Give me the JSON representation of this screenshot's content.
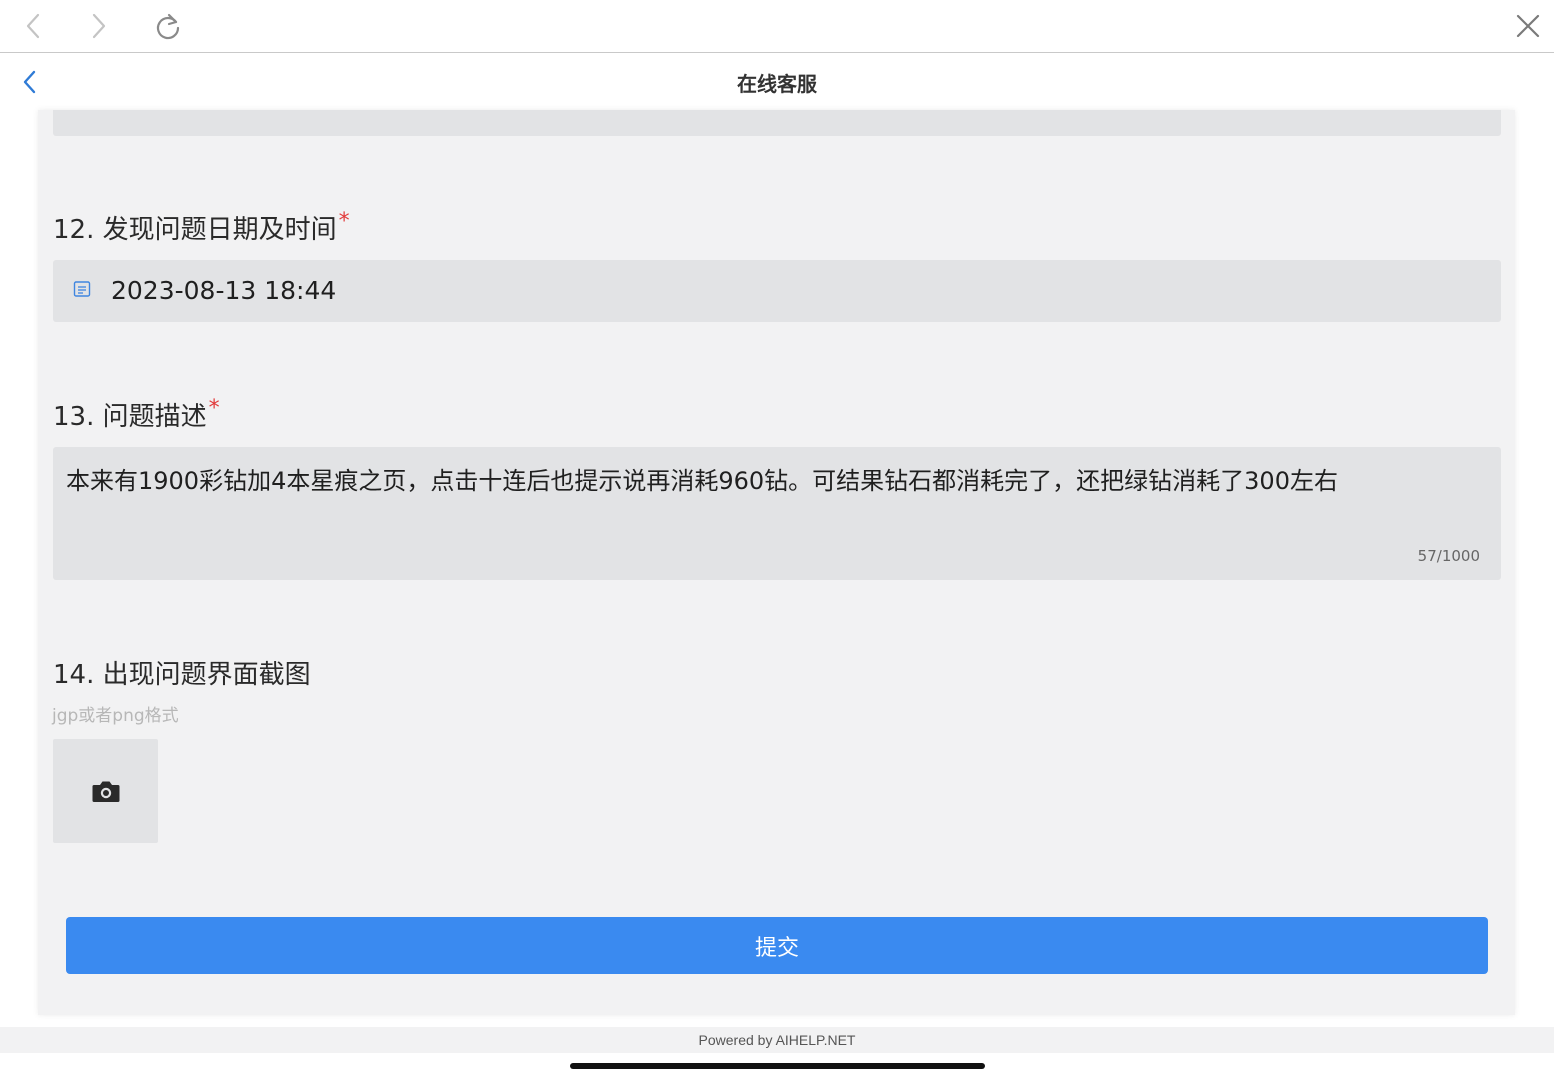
{
  "browser": {
    "back_icon": "chevron-left-icon",
    "forward_icon": "chevron-right-icon",
    "reload_icon": "reload-icon",
    "close_icon": "close-icon"
  },
  "header": {
    "title": "在线客服",
    "back_icon": "chevron-left-icon",
    "accent": "#2f7bd6"
  },
  "form": {
    "q12": {
      "label": "12. 发现问题日期及时间",
      "required_mark": "*",
      "value": "2023-08-13 18:44",
      "icon": "calendar-icon"
    },
    "q13": {
      "label": "13. 问题描述",
      "required_mark": "*",
      "value": "本来有1900彩钻加4本星痕之页，点击十连后也提示说再消耗960钻。可结果钻石都消耗完了，还把绿钻消耗了300左右",
      "counter": "57/1000"
    },
    "q14": {
      "label": "14. 出现问题界面截图",
      "hint": "jgp或者png格式",
      "upload_icon": "camera-icon"
    },
    "submit_label": "提交",
    "submit_color": "#3a8af0",
    "required_color": "#e23b3b"
  },
  "footer": {
    "powered_by": "Powered by AIHELP.NET"
  }
}
